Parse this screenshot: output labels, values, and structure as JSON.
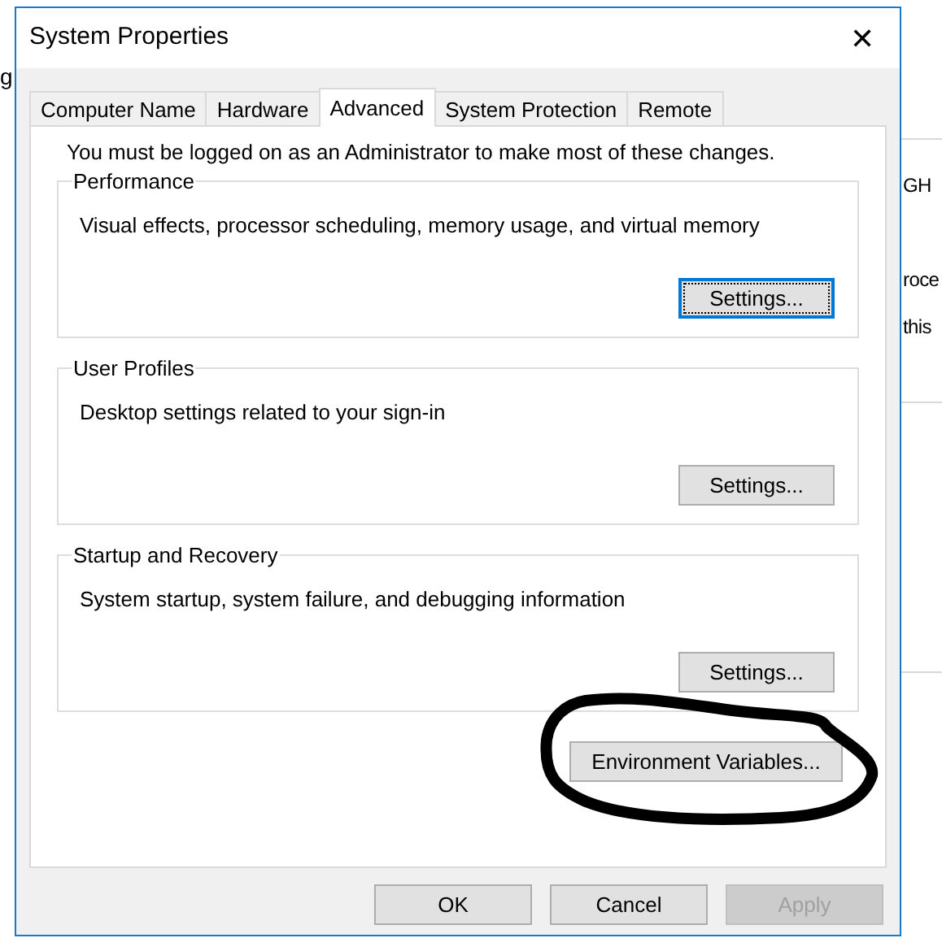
{
  "background_window": {
    "left_fragment": "g",
    "right_fragments": [
      "GH",
      "roce",
      "this"
    ]
  },
  "window": {
    "title": "System Properties",
    "close": "✕"
  },
  "tabs": [
    {
      "label": "Computer Name",
      "selected": false
    },
    {
      "label": "Hardware",
      "selected": false
    },
    {
      "label": "Advanced",
      "selected": true
    },
    {
      "label": "System Protection",
      "selected": false
    },
    {
      "label": "Remote",
      "selected": false
    }
  ],
  "notice": "You must be logged on as an Administrator to make most of these changes.",
  "groups": [
    {
      "title": "Performance",
      "description": "Visual effects, processor scheduling, memory usage, and virtual memory",
      "button": {
        "label": "Settings...",
        "focused": true
      }
    },
    {
      "title": "User Profiles",
      "description": "Desktop settings related to your sign-in",
      "button": {
        "label": "Settings...",
        "focused": false
      }
    },
    {
      "title": "Startup and Recovery",
      "description": "System startup, system failure, and debugging information",
      "button": {
        "label": "Settings...",
        "focused": false
      }
    }
  ],
  "environment_button": {
    "label": "Environment Variables...",
    "circled": true
  },
  "buttons": [
    {
      "label": "OK",
      "disabled": false
    },
    {
      "label": "Cancel",
      "disabled": false
    },
    {
      "label": "Apply",
      "disabled": true
    }
  ]
}
